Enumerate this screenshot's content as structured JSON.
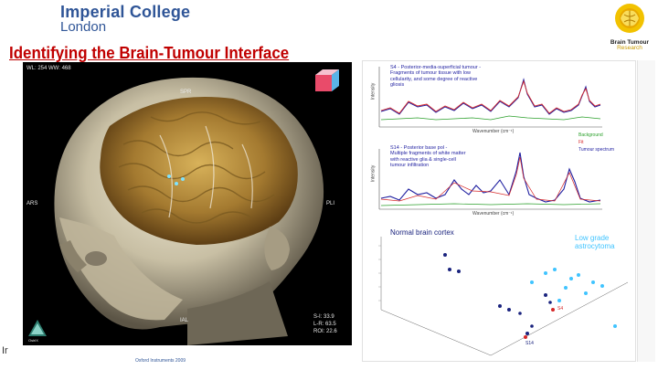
{
  "header": {
    "institution_line1": "Imperial College",
    "institution_line2": "London",
    "title": "Identifying the Brain-Tumour Interface"
  },
  "logo": {
    "name": "brain-tumour-research-logo",
    "line1": "Brain Tumour",
    "line2": "Research"
  },
  "mri": {
    "wl_text": "WL: 254 WW: 468",
    "top_label": "SPR",
    "left_label": "ARS",
    "right_label": "PLI",
    "bottom_label": "IAL",
    "coord_s": "S-I: 33.9",
    "coord_lr": "L-R: 63.5",
    "coord_roi": "ROI: 22.6",
    "vendor": "OsiriX"
  },
  "footer": {
    "left_text": "Ir",
    "credit": "Oxford Instruments 2009"
  },
  "spectra": {
    "top_text": [
      "S4 - Posterior-media-superficial tumour -",
      "Fragments of tumour tissue with low",
      "cellularity, and some degree of reactive",
      "gliosis"
    ],
    "bottom_text": [
      "S14 - Posterior base pol -",
      "Multiple fragments of white matter",
      "with reactive glia & single-cell",
      "tumour infiltration"
    ],
    "legend": [
      "Background",
      "Fit",
      "Tumour spectrum"
    ],
    "legend_colors": [
      "#2ca02c",
      "#d62728",
      "#1f1fa0"
    ],
    "y_label": "Intensity",
    "x_label": "Wavenumber (cm⁻¹)"
  },
  "scatter": {
    "normal_label": "Normal brain cortex",
    "tumour_label_1": "Low grade",
    "tumour_label_2": "astrocytoma",
    "point_label_1": "S4",
    "point_label_2": "S14",
    "normal_color": "#1a237e",
    "tumour_color": "#40c4ff"
  }
}
